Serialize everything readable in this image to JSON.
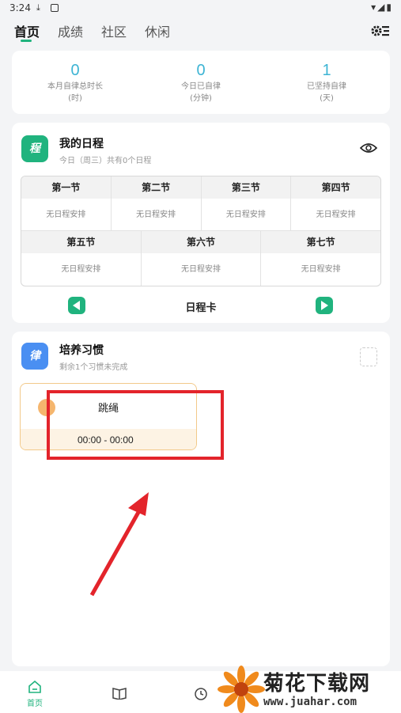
{
  "status_bar": {
    "time": "3:24"
  },
  "top_tabs": [
    {
      "label": "首页",
      "active": true
    },
    {
      "label": "成绩",
      "active": false
    },
    {
      "label": "社区",
      "active": false
    },
    {
      "label": "休闲",
      "active": false
    }
  ],
  "stats": [
    {
      "value": "0",
      "label": "本月自律总时长",
      "unit": "(时)"
    },
    {
      "value": "0",
      "label": "今日已自律",
      "unit": "(分钟)"
    },
    {
      "value": "1",
      "label": "已坚持自律",
      "unit": "(天)"
    }
  ],
  "schedule": {
    "icon_text": "程",
    "title": "我的日程",
    "subtitle": "今日（周三）共有0个日程",
    "row1": [
      {
        "name": "第一节",
        "status": "无日程安排"
      },
      {
        "name": "第二节",
        "status": "无日程安排"
      },
      {
        "name": "第三节",
        "status": "无日程安排"
      },
      {
        "name": "第四节",
        "status": "无日程安排"
      }
    ],
    "row2": [
      {
        "name": "第五节",
        "status": "无日程安排"
      },
      {
        "name": "第六节",
        "status": "无日程安排"
      },
      {
        "name": "第七节",
        "status": "无日程安排"
      }
    ],
    "card_label": "日程卡"
  },
  "habits": {
    "icon_text": "律",
    "title": "培养习惯",
    "subtitle": "剩余1个习惯未完成",
    "items": [
      {
        "name": "跳绳",
        "time": "00:00 - 00:00"
      }
    ]
  },
  "bottom_nav": {
    "home_label": "首页"
  },
  "watermark": {
    "title": "菊花下载网",
    "url": "www.juahar.com"
  },
  "colors": {
    "accent": "#20b37e",
    "stat_number": "#3db4d4",
    "habit_icon": "#4a8ff2",
    "highlight": "#e3242b"
  }
}
